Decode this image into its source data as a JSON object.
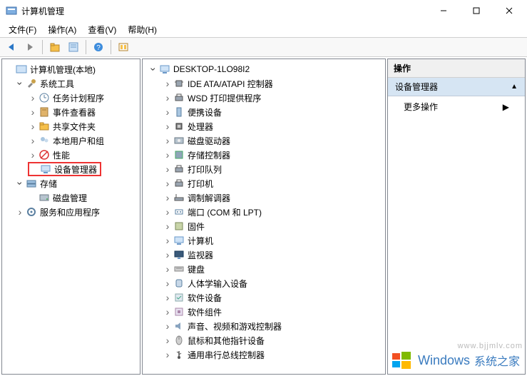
{
  "window": {
    "title": "计算机管理"
  },
  "menu": {
    "file": "文件(F)",
    "action": "操作(A)",
    "view": "查看(V)",
    "help": "帮助(H)"
  },
  "left_tree": {
    "root": {
      "label": "计算机管理(本地)"
    },
    "system_tools": {
      "label": "系统工具"
    },
    "system_children": [
      {
        "key": "task-scheduler",
        "label": "任务计划程序",
        "icon": "clock-icon",
        "has_children": true
      },
      {
        "key": "event-viewer",
        "label": "事件查看器",
        "icon": "book-icon",
        "has_children": true
      },
      {
        "key": "shared-folders",
        "label": "共享文件夹",
        "icon": "folder-share-icon",
        "has_children": true
      },
      {
        "key": "local-users",
        "label": "本地用户和组",
        "icon": "users-icon",
        "has_children": true
      },
      {
        "key": "performance",
        "label": "性能",
        "icon": "perf-icon",
        "has_children": true
      },
      {
        "key": "device-manager",
        "label": "设备管理器",
        "icon": "device-icon",
        "has_children": false,
        "highlight": true
      }
    ],
    "storage": {
      "label": "存储"
    },
    "storage_children": [
      {
        "key": "disk-management",
        "label": "磁盘管理",
        "icon": "disk-icon",
        "has_children": false
      }
    ],
    "services": {
      "label": "服务和应用程序",
      "has_children": true
    }
  },
  "device_tree": {
    "root": "DESKTOP-1LO98I2",
    "items": [
      {
        "key": "ide",
        "label": "IDE ATA/ATAPI 控制器",
        "icon": "chip-icon"
      },
      {
        "key": "wsd",
        "label": "WSD 打印提供程序",
        "icon": "printer-icon"
      },
      {
        "key": "portable",
        "label": "便携设备",
        "icon": "portable-icon"
      },
      {
        "key": "cpu",
        "label": "处理器",
        "icon": "cpu-icon"
      },
      {
        "key": "diskdrive",
        "label": "磁盘驱动器",
        "icon": "hdd-icon"
      },
      {
        "key": "storagectl",
        "label": "存储控制器",
        "icon": "storage-icon"
      },
      {
        "key": "printqueue",
        "label": "打印队列",
        "icon": "printer-icon"
      },
      {
        "key": "printer",
        "label": "打印机",
        "icon": "printer-icon"
      },
      {
        "key": "modem",
        "label": "调制解调器",
        "icon": "modem-icon"
      },
      {
        "key": "ports",
        "label": "端口 (COM 和 LPT)",
        "icon": "port-icon"
      },
      {
        "key": "firmware",
        "label": "固件",
        "icon": "firmware-icon"
      },
      {
        "key": "computer",
        "label": "计算机",
        "icon": "computer-icon"
      },
      {
        "key": "monitor",
        "label": "监视器",
        "icon": "monitor-icon"
      },
      {
        "key": "keyboard",
        "label": "键盘",
        "icon": "keyboard-icon"
      },
      {
        "key": "hid",
        "label": "人体学输入设备",
        "icon": "hid-icon"
      },
      {
        "key": "swdev",
        "label": "软件设备",
        "icon": "swdev-icon"
      },
      {
        "key": "swcomp",
        "label": "软件组件",
        "icon": "swcomp-icon"
      },
      {
        "key": "audio",
        "label": "声音、视频和游戏控制器",
        "icon": "audio-icon"
      },
      {
        "key": "mouse",
        "label": "鼠标和其他指针设备",
        "icon": "mouse-icon"
      },
      {
        "key": "usb",
        "label": "通用串行总线控制器",
        "icon": "usb-icon"
      }
    ]
  },
  "actions": {
    "header": "操作",
    "device_manager": "设备管理器",
    "more": "更多操作"
  },
  "watermark": {
    "brand": "Windows",
    "site": "系统之家",
    "url": "www.bjjmlv.com"
  }
}
